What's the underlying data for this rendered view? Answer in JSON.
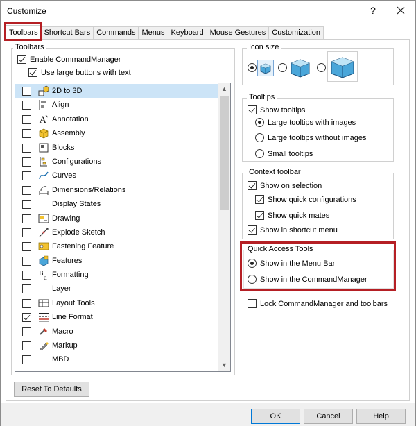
{
  "window": {
    "title": "Customize",
    "help_glyph": "?",
    "close_glyph": "✕"
  },
  "tabs": [
    {
      "label": "Toolbars",
      "active": true
    },
    {
      "label": "Shortcut Bars"
    },
    {
      "label": "Commands"
    },
    {
      "label": "Menus"
    },
    {
      "label": "Keyboard"
    },
    {
      "label": "Mouse Gestures"
    },
    {
      "label": "Customization"
    }
  ],
  "toolbars_group": {
    "legend": "Toolbars",
    "enable_commandmanager": {
      "label": "Enable CommandManager",
      "checked": true
    },
    "use_large_buttons": {
      "label": "Use large buttons with text",
      "checked": true
    },
    "items": [
      {
        "label": "2D to 3D",
        "checked": false,
        "icon": "2d-to-3d-icon",
        "selected": true
      },
      {
        "label": "Align",
        "checked": false,
        "icon": "align-icon"
      },
      {
        "label": "Annotation",
        "checked": false,
        "icon": "annotation-icon"
      },
      {
        "label": "Assembly",
        "checked": false,
        "icon": "assembly-icon"
      },
      {
        "label": "Blocks",
        "checked": false,
        "icon": "blocks-icon"
      },
      {
        "label": "Configurations",
        "checked": false,
        "icon": "configurations-icon"
      },
      {
        "label": "Curves",
        "checked": false,
        "icon": "curves-icon"
      },
      {
        "label": "Dimensions/Relations",
        "checked": false,
        "icon": "dimensions-icon"
      },
      {
        "label": "Display States",
        "checked": false,
        "icon": ""
      },
      {
        "label": "Drawing",
        "checked": false,
        "icon": "drawing-icon"
      },
      {
        "label": "Explode Sketch",
        "checked": false,
        "icon": "explode-sketch-icon"
      },
      {
        "label": "Fastening Feature",
        "checked": false,
        "icon": "fastening-feature-icon"
      },
      {
        "label": "Features",
        "checked": false,
        "icon": "features-icon"
      },
      {
        "label": "Formatting",
        "checked": false,
        "icon": "formatting-icon"
      },
      {
        "label": "Layer",
        "checked": false,
        "icon": ""
      },
      {
        "label": "Layout Tools",
        "checked": false,
        "icon": "layout-tools-icon"
      },
      {
        "label": "Line Format",
        "checked": true,
        "icon": "line-format-icon"
      },
      {
        "label": "Macro",
        "checked": false,
        "icon": "macro-icon"
      },
      {
        "label": "Markup",
        "checked": false,
        "icon": "markup-icon"
      },
      {
        "label": "MBD",
        "checked": false,
        "icon": ""
      }
    ],
    "scroll_up": "▲",
    "scroll_down": "▼"
  },
  "icon_size": {
    "legend": "Icon size",
    "selected": "small"
  },
  "tooltips": {
    "legend": "Tooltips",
    "show_tooltips": "Show tooltips",
    "large_with_images": "Large tooltips with images",
    "large_without_images": "Large tooltips without images",
    "small_tooltips": "Small tooltips"
  },
  "context_toolbar": {
    "legend": "Context toolbar",
    "show_on_selection": "Show on selection",
    "show_quick_configurations": "Show quick configurations",
    "show_quick_mates": "Show quick mates",
    "show_in_shortcut_menu": "Show in shortcut menu"
  },
  "quick_access": {
    "legend": "Quick Access Tools",
    "menu_bar": "Show in the Menu Bar",
    "commandmanager": "Show in the CommandManager"
  },
  "lock_toolbars": "Lock CommandManager and toolbars",
  "buttons": {
    "reset": "Reset To Defaults",
    "ok": "OK",
    "cancel": "Cancel",
    "help": "Help"
  },
  "colors": {
    "highlight_red": "#b51f24",
    "selection_blue": "#cce4f7"
  }
}
